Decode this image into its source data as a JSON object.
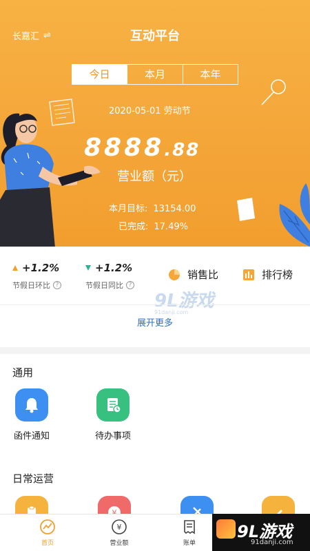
{
  "header": {
    "store_name": "长嘉汇",
    "swap_icon": "⇌",
    "title": "互动平台"
  },
  "segment": {
    "tabs": [
      "今日",
      "本月",
      "本年"
    ],
    "active": "今日"
  },
  "summary": {
    "date": "2020-05-01 劳动节",
    "amount_int": "8888",
    "amount_dec": ".88",
    "amount_label": "营业额（元）",
    "target_label": "本月目标:",
    "target_value": "13154.00",
    "done_label": "已完成:",
    "done_value": "17.49%"
  },
  "stats": {
    "holiday_ring": {
      "value": "+1.2%",
      "label": "节假日环比",
      "trend": "up"
    },
    "holiday_yoy": {
      "value": "+1.2%",
      "label": "节假日同比",
      "trend": "down"
    },
    "sales_ratio": "销售比",
    "ranking": "排行榜",
    "expand": "展开更多",
    "watermark": "9L游戏",
    "watermark_sub": "91danji.com"
  },
  "general": {
    "title": "通用",
    "items": [
      {
        "label": "函件通知",
        "icon": "bell-icon",
        "color": "#3d8ff2"
      },
      {
        "label": "待办事项",
        "icon": "todo-icon",
        "color": "#37c07f"
      }
    ]
  },
  "daily": {
    "title": "日常运营",
    "items": [
      {
        "icon": "clipboard-icon",
        "color": "#f5b23c"
      },
      {
        "icon": "yuan-icon",
        "color": "#f06a6a"
      },
      {
        "icon": "tools-icon",
        "color": "#3d8ff2"
      },
      {
        "icon": "pencil-icon",
        "color": "#f5b23c"
      }
    ]
  },
  "tabbar": {
    "items": [
      {
        "label": "首页",
        "icon": "home-chart-icon",
        "active": true
      },
      {
        "label": "营业额",
        "icon": "yuan-circle-icon",
        "active": false
      },
      {
        "label": "账单",
        "icon": "bill-icon",
        "active": false
      }
    ]
  },
  "corner_watermark": {
    "text": "9L游戏",
    "sub": "91danji.com"
  },
  "colors": {
    "accent": "#f5a73a",
    "link": "#2a6fc9",
    "up": "#f0a030",
    "down": "#2bb39a"
  }
}
